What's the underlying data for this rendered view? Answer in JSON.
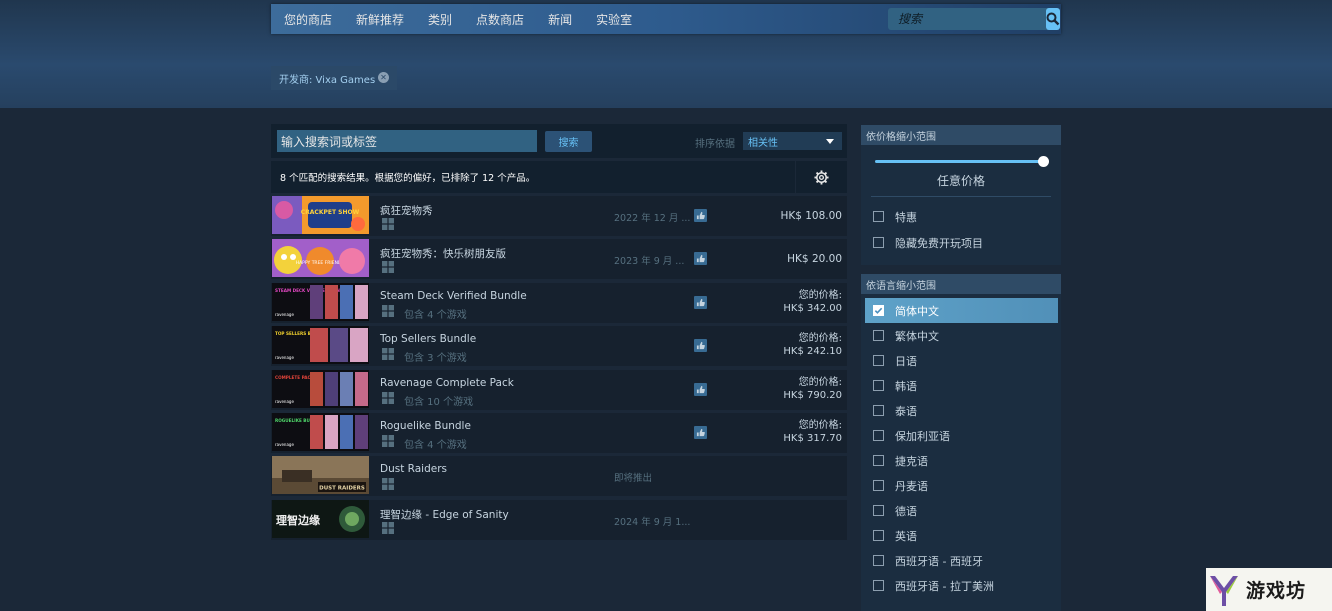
{
  "nav": {
    "items": [
      "您的商店",
      "新鲜推荐",
      "类别",
      "点数商店",
      "新闻",
      "实验室"
    ],
    "search_placeholder": "搜索"
  },
  "filter_tag": {
    "label": "开发商: Vixa Games"
  },
  "search": {
    "term_value": "输入搜索词或标签",
    "button_label": "搜索",
    "sort_label": "排序依据",
    "sort_value": "相关性"
  },
  "results": {
    "summary": "8 个匹配的搜索结果。根据您的偏好，已排除了 12 个产品。",
    "rows": [
      {
        "title": "疯狂宠物秀",
        "sub": "",
        "date": "2022 年 12 月 ...",
        "price": "HK$ 108.00",
        "price_label": "",
        "has_review": true
      },
      {
        "title": "疯狂宠物秀：快乐树朋友版",
        "sub": "",
        "date": "2023 年 9 月 ...",
        "price": "HK$ 20.00",
        "price_label": "",
        "has_review": true
      },
      {
        "title": "Steam Deck Verified Bundle",
        "sub": "包含 4 个游戏",
        "date": "",
        "price": "HK$ 342.00",
        "price_label": "您的价格:",
        "has_review": true
      },
      {
        "title": "Top Sellers Bundle",
        "sub": "包含 3 个游戏",
        "date": "",
        "price": "HK$ 242.10",
        "price_label": "您的价格:",
        "has_review": true
      },
      {
        "title": "Ravenage Complete Pack",
        "sub": "包含 10 个游戏",
        "date": "",
        "price": "HK$ 790.20",
        "price_label": "您的价格:",
        "has_review": true
      },
      {
        "title": "Roguelike Bundle",
        "sub": "包含 4 个游戏",
        "date": "",
        "price": "HK$ 317.70",
        "price_label": "您的价格:",
        "has_review": true
      },
      {
        "title": "Dust Raiders",
        "sub": "",
        "date": "即将推出",
        "price": "",
        "price_label": "",
        "has_review": false
      },
      {
        "title": "理智边缘 - Edge of Sanity",
        "sub": "",
        "date": "2024 年 9 月 1...",
        "price": "",
        "price_label": "",
        "has_review": false
      }
    ],
    "capsule_text": {
      "crackpet": "CRACKPET SHOW",
      "tree": "HAPPY TREE FRIENDS",
      "bundle_steam": "STEAM DECK VERIFIED BUNDLE",
      "bundle_top": "TOP SELLERS BUNDLE",
      "bundle_complete": "COMPLETE PACK",
      "bundle_rogue": "ROGUELIKE BUNDLE",
      "publisher": "ravenage",
      "dust": "DUST RAIDERS",
      "sanity": "理智边缘"
    }
  },
  "price_panel": {
    "header": "依价格缩小范围",
    "price_label": "任意价格",
    "options": [
      "特惠",
      "隐藏免费开玩项目"
    ]
  },
  "lang_panel": {
    "header": "依语言缩小范围",
    "options": [
      {
        "label": "简体中文",
        "checked": true
      },
      {
        "label": "繁体中文",
        "checked": false
      },
      {
        "label": "日语",
        "checked": false
      },
      {
        "label": "韩语",
        "checked": false
      },
      {
        "label": "泰语",
        "checked": false
      },
      {
        "label": "保加利亚语",
        "checked": false
      },
      {
        "label": "捷克语",
        "checked": false
      },
      {
        "label": "丹麦语",
        "checked": false
      },
      {
        "label": "德语",
        "checked": false
      },
      {
        "label": "英语",
        "checked": false
      },
      {
        "label": "西班牙语 - 西班牙",
        "checked": false
      },
      {
        "label": "西班牙语 - 拉丁美洲",
        "checked": false
      }
    ]
  },
  "watermark": {
    "text": "游戏坊"
  }
}
